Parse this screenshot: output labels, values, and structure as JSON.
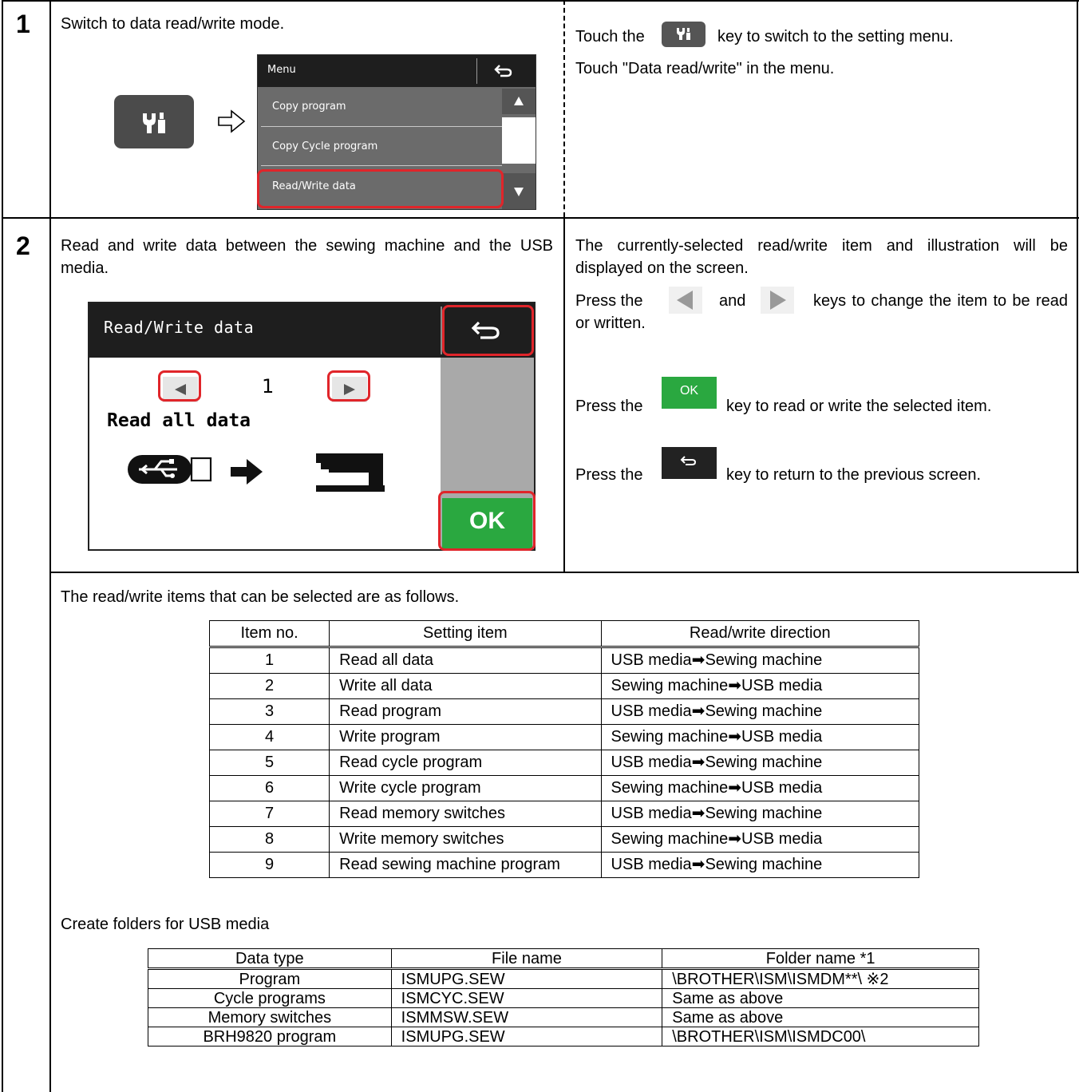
{
  "step1": {
    "number": "1",
    "instruction": "Switch to data read/write mode.",
    "menu_screen": {
      "title": "Menu",
      "items": [
        "Copy program",
        "Copy Cycle program",
        "Read/Write data"
      ]
    },
    "desc_prefix": "Touch the",
    "desc_suffix": "key to switch to the setting menu.",
    "desc_line2": "Touch \"Data read/write\" in the menu."
  },
  "step2": {
    "number": "2",
    "instruction": "Read and write data between the sewing machine and the USB media.",
    "screen": {
      "title": "Read/Write data",
      "item_number": "1",
      "item_label": "Read all data",
      "ok_label": "OK"
    },
    "desc_line1": "The currently-selected read/write item and illustration will be displayed on the screen.",
    "press_the": "Press the",
    "and": "and",
    "arrows_suffix": "keys to change the item to be read or written.",
    "ok_key_label": "OK",
    "ok_suffix": "key to read or write the selected item.",
    "back_suffix": "key to return to the previous screen."
  },
  "items_intro": "The read/write items that can be selected are as follows.",
  "items_table": {
    "headers": [
      "Item no.",
      "Setting item",
      "Read/write direction"
    ],
    "rows": [
      [
        "1",
        "Read all data",
        "USB media➡Sewing machine"
      ],
      [
        "2",
        "Write all data",
        "Sewing machine➡USB media"
      ],
      [
        "3",
        "Read program",
        "USB media➡Sewing machine"
      ],
      [
        "4",
        "Write program",
        "Sewing machine➡USB media"
      ],
      [
        "5",
        "Read cycle program",
        "USB media➡Sewing machine"
      ],
      [
        "6",
        "Write cycle program",
        "Sewing machine➡USB media"
      ],
      [
        "7",
        "Read memory switches",
        "USB media➡Sewing machine"
      ],
      [
        "8",
        "Write memory switches",
        "Sewing machine➡USB media"
      ],
      [
        "9",
        "Read sewing machine program",
        "USB media➡Sewing machine"
      ]
    ]
  },
  "folders_intro": "Create folders for USB media",
  "folders_table": {
    "headers": [
      "Data type",
      "File name",
      "Folder name *1"
    ],
    "rows": [
      [
        "Program",
        "ISMUPG.SEW",
        "\\BROTHER\\ISM\\ISMDM**\\ ※2"
      ],
      [
        "Cycle programs",
        "ISMCYC.SEW",
        "Same as above"
      ],
      [
        "Memory switches",
        "ISMMSW.SEW",
        "Same as above"
      ],
      [
        "BRH9820 program",
        "ISMUPG.SEW",
        "\\BROTHER\\ISM\\ISMDC00\\"
      ]
    ]
  }
}
